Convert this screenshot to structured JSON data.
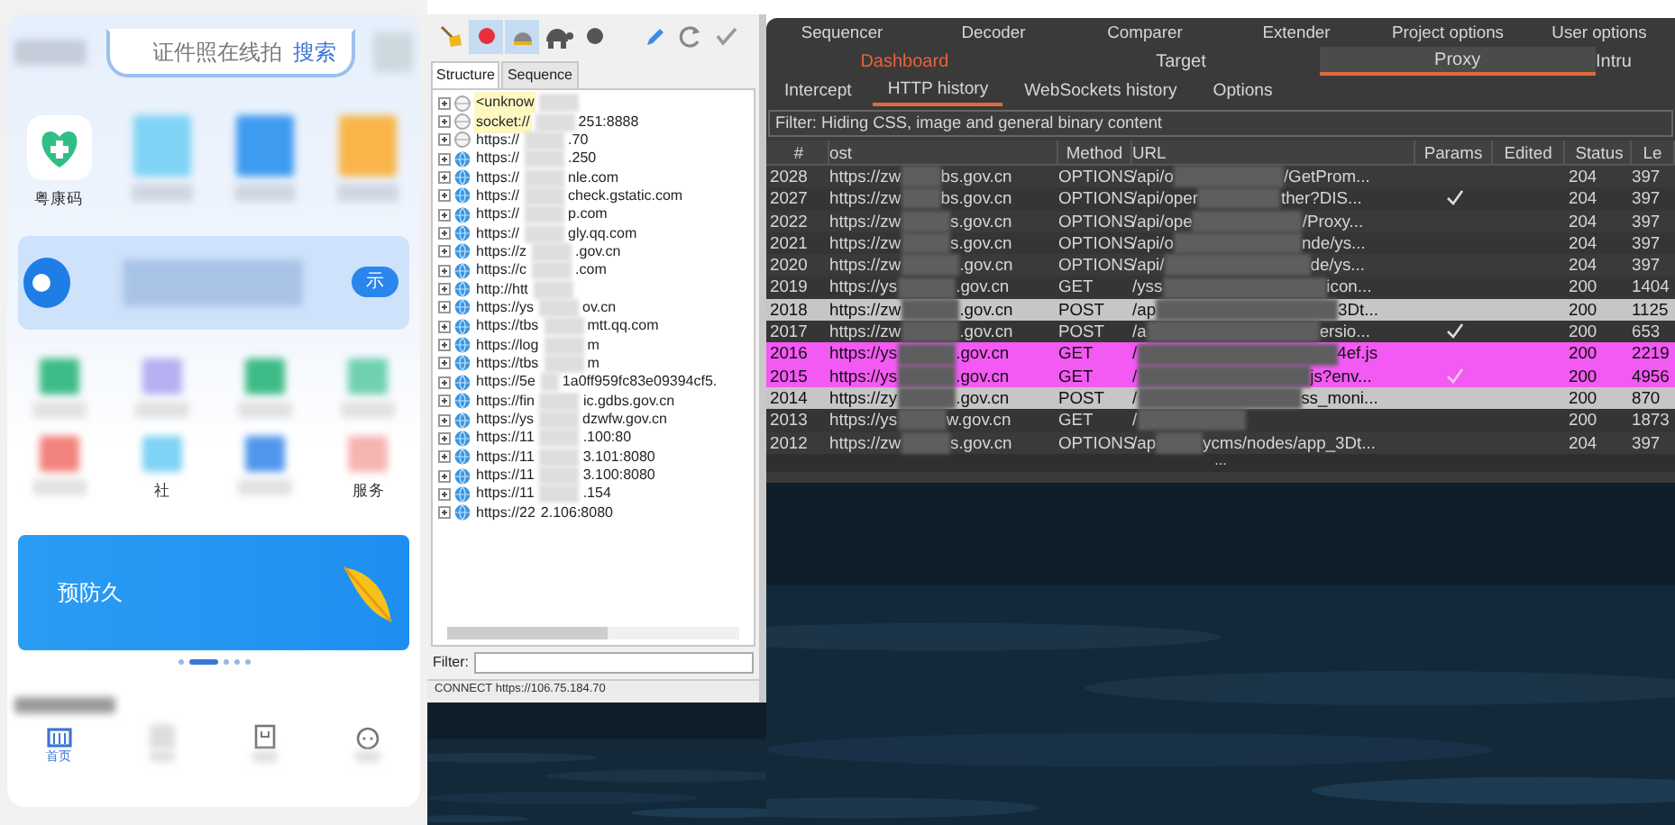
{
  "phone": {
    "search": {
      "placeholder": "证件照在线拍",
      "button": "搜索"
    },
    "apps": [
      {
        "kind": "health",
        "label": "粤康码"
      },
      {
        "kind": "mosaic",
        "color": "#7fd3f5"
      },
      {
        "kind": "mosaic",
        "color": "#3d9bf0"
      },
      {
        "kind": "mosaic",
        "color": "#f9b54a"
      }
    ],
    "banner": {
      "button": "示"
    },
    "grid": [
      {
        "color": "#3dbb86"
      },
      {
        "color": "#b4b0f2"
      },
      {
        "color": "#3dbb86"
      },
      {
        "color": "#6fd1b0"
      },
      {
        "color": "#f2837c"
      },
      {
        "color": "#7fd3f5",
        "label": "社"
      },
      {
        "color": "#4f97ec"
      },
      {
        "color": "#f6b4b0",
        "label": "服务"
      }
    ],
    "promo": {
      "text": "预防久"
    },
    "dots": [
      {
        "selected": false
      },
      {
        "selected": true
      },
      {
        "selected": false
      },
      {
        "selected": false
      },
      {
        "selected": false
      }
    ],
    "nav": [
      {
        "label": "首页",
        "selected": true
      },
      {
        "selected": false
      },
      {
        "selected": false
      },
      {
        "selected": false
      }
    ]
  },
  "charles": {
    "toolbar": [
      {
        "kind": "broom",
        "selected": false
      },
      {
        "kind": "record",
        "selected": true
      },
      {
        "kind": "throttle",
        "selected": true
      },
      {
        "kind": "turtle",
        "selected": false
      },
      {
        "kind": "stop",
        "selected": false
      },
      {
        "kind": "pen",
        "selected": false
      },
      {
        "kind": "refresh",
        "selected": false
      },
      {
        "kind": "check",
        "selected": false
      }
    ],
    "tabs": [
      {
        "label": "Structure",
        "selected": true
      },
      {
        "label": "Sequence",
        "selected": false
      }
    ],
    "tree": [
      {
        "kind": "plain",
        "highlighted": true,
        "start": "<unknow"
      },
      {
        "kind": "plain",
        "highlighted": true,
        "start": "socket://",
        "end": "251:8888"
      },
      {
        "kind": "plain",
        "highlighted": false,
        "start": "https://",
        "end": ".70"
      },
      {
        "kind": "globe",
        "highlighted": false,
        "start": "https://",
        "end": ".250"
      },
      {
        "kind": "globe",
        "highlighted": false,
        "start": "https://",
        "end": "nle.com"
      },
      {
        "kind": "globe",
        "highlighted": false,
        "start": "https://",
        "end": "check.gstatic.com"
      },
      {
        "kind": "globe",
        "highlighted": false,
        "start": "https://",
        "end": "p.com"
      },
      {
        "kind": "globe",
        "highlighted": false,
        "start": "https://",
        "end": "gly.qq.com"
      },
      {
        "kind": "globe",
        "highlighted": false,
        "start": "https://z",
        "end": ".gov.cn"
      },
      {
        "kind": "globe",
        "highlighted": false,
        "start": "https://c",
        "end": ".com"
      },
      {
        "kind": "globe",
        "highlighted": false,
        "start": "http://htt"
      },
      {
        "kind": "globe",
        "highlighted": false,
        "start": "https://ys",
        "end": "ov.cn"
      },
      {
        "kind": "globe",
        "highlighted": false,
        "start": "https://tbs",
        "end": "mtt.qq.com"
      },
      {
        "kind": "globe",
        "highlighted": false,
        "start": "https://log",
        "end": "m"
      },
      {
        "kind": "globe",
        "highlighted": false,
        "start": "https://tbs",
        "end": "m"
      },
      {
        "kind": "globe",
        "highlighted": false,
        "start": "https://5e",
        "end": "1a0ff959fc83e09394cf5."
      },
      {
        "kind": "globe",
        "highlighted": false,
        "start": "https://fin",
        "end": "ic.gdbs.gov.cn"
      },
      {
        "kind": "globe",
        "highlighted": false,
        "start": "https://ys",
        "end": "dzwfw.gov.cn"
      },
      {
        "kind": "globe",
        "highlighted": false,
        "start": "https://11",
        "end": ".100:80"
      },
      {
        "kind": "globe",
        "highlighted": false,
        "start": "https://11",
        "end": "3.101:8080"
      },
      {
        "kind": "globe",
        "highlighted": false,
        "start": "https://11",
        "end": "3.100:8080"
      },
      {
        "kind": "globe",
        "highlighted": false,
        "start": "https://11",
        "end": ".154"
      },
      {
        "kind": "globe",
        "highlighted": false,
        "start": "https://22",
        "end": "2.106:8080"
      }
    ],
    "filter_label": "Filter:",
    "status": "CONNECT https://106.75.184.70"
  },
  "burp": {
    "tabs_row1": [
      "Sequencer",
      "Decoder",
      "Comparer",
      "Extender",
      "Project options",
      "User options"
    ],
    "tabs_row2": [
      {
        "label": "Dashboard",
        "selected": false,
        "alert": true
      },
      {
        "label": "Target",
        "selected": false,
        "alert": false
      },
      {
        "label": "Proxy",
        "selected": true,
        "alert": false
      },
      {
        "label": "Intru",
        "selected": false,
        "alert": false
      }
    ],
    "subtabs": [
      {
        "label": "Intercept",
        "selected": false
      },
      {
        "label": "HTTP history",
        "selected": true
      },
      {
        "label": "WebSockets history",
        "selected": false
      },
      {
        "label": "Options",
        "selected": false
      }
    ],
    "filter": "Filter: Hiding CSS, image and general binary content",
    "columns": [
      "#",
      "ost",
      "Method",
      "URL",
      "Params",
      "Edited",
      "Status",
      "Le"
    ],
    "rows": [
      {
        "id": "2028",
        "host_start": "https://zw",
        "host_end": "bs.gov.cn",
        "method": "OPTIONS",
        "url_start": "/api/o",
        "url_end": "/GetProm...",
        "params": false,
        "status": "204",
        "length": "397"
      },
      {
        "id": "2027",
        "host_start": "https://zw",
        "host_end": "bs.gov.cn",
        "method": "OPTIONS",
        "url_start": "/api/oper",
        "url_end": "ther?DIS...",
        "params": true,
        "status": "204",
        "length": "397"
      },
      {
        "id": "2022",
        "host_start": "https://zw",
        "host_end": "s.gov.cn",
        "method": "OPTIONS",
        "url_start": "/api/ope",
        "url_end": "/Proxy...",
        "params": false,
        "status": "204",
        "length": "397"
      },
      {
        "id": "2021",
        "host_start": "https://zw",
        "host_end": "s.gov.cn",
        "method": "OPTIONS",
        "url_start": "/api/o",
        "url_end": "nde/ys...",
        "params": false,
        "status": "204",
        "length": "397"
      },
      {
        "id": "2020",
        "host_start": "https://zw",
        "host_end": ".gov.cn",
        "method": "OPTIONS",
        "url_start": "/api/",
        "url_end": "de/ys...",
        "params": false,
        "status": "204",
        "length": "397"
      },
      {
        "id": "2019",
        "host_start": "https://ys",
        "host_end": ".gov.cn",
        "method": "GET",
        "url_start": "/yss",
        "url_end": "icon...",
        "params": false,
        "status": "200",
        "length": "1404"
      },
      {
        "id": "2018",
        "host_start": "https://zw",
        "host_end": ".gov.cn",
        "method": "POST",
        "url_start": "/ap",
        "url_end": "3Dt...",
        "params": false,
        "status": "200",
        "length": "1125",
        "color": "#c6c6c6"
      },
      {
        "id": "2017",
        "host_start": "https://zw",
        "host_end": ".gov.cn",
        "method": "POST",
        "url_start": "/a",
        "url_end": "ersio...",
        "params": true,
        "status": "200",
        "length": "653"
      },
      {
        "id": "2016",
        "host_start": "https://ys",
        "host_end": ".gov.cn",
        "method": "GET",
        "url_start": "/",
        "url_end": "4ef.js",
        "params": false,
        "status": "200",
        "length": "2219",
        "color": "#f359f3"
      },
      {
        "id": "2015",
        "host_start": "https://ys",
        "host_end": ".gov.cn",
        "method": "GET",
        "url_start": "/",
        "url_end": "js?env...",
        "params": true,
        "status": "200",
        "length": "4956",
        "color": "#f359f3"
      },
      {
        "id": "2014",
        "host_start": "https://zy",
        "host_end": ".gov.cn",
        "method": "POST",
        "url_start": "/",
        "url_end": "ss_moni...",
        "params": false,
        "status": "200",
        "length": "870",
        "color": "#c6c6c6"
      },
      {
        "id": "2013",
        "host_start": "https://ys",
        "host_end": "w.gov.cn",
        "method": "GET",
        "url_start": "/",
        "params": false,
        "status": "200",
        "length": "1873"
      },
      {
        "id": "2012",
        "host_start": "https://zw",
        "host_end": "s.gov.cn",
        "method": "OPTIONS",
        "url_start": "/ap",
        "url_end": "ycms/nodes/app_3Dt...",
        "params": false,
        "status": "204",
        "length": "397"
      }
    ],
    "splitter": "..."
  }
}
